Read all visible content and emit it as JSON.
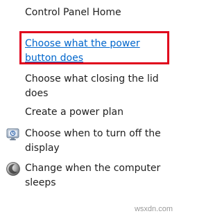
{
  "sidebar": {
    "items": [
      {
        "label": "Control Panel Home"
      },
      {
        "label": "Choose what the power button does"
      },
      {
        "label": "Choose what closing the lid does"
      },
      {
        "label": "Create a power plan"
      },
      {
        "label": "Choose when to turn off the display",
        "icon": "display-power-icon"
      },
      {
        "label": "Change when the computer sleeps",
        "icon": "sleep-moon-icon"
      }
    ]
  },
  "highlight": {
    "color": "#e0001b"
  },
  "link_color": "#0066cc",
  "watermark": "wsxdn.com"
}
